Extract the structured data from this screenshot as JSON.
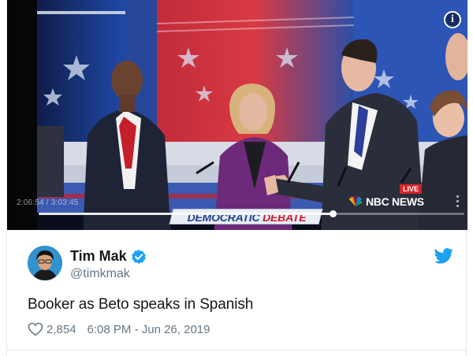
{
  "video": {
    "timestamp": "2:06:54 / 3:03:45",
    "live_label": "LIVE",
    "network_name": "NBC NEWS",
    "banner_part1": "DEMOCRATIC ",
    "banner_part2": "DEBATE",
    "progress_fraction": 0.69,
    "info_label": "i"
  },
  "tweet": {
    "author_name": "Tim Mak",
    "handle": "@timkmak",
    "text": "Booker as Beto speaks in Spanish",
    "likes": "2,854",
    "time": "6:08 PM - Jun 26, 2019"
  },
  "colors": {
    "twitter_blue": "#1da1f2",
    "text_primary": "#14171a",
    "text_secondary": "#657786",
    "live_red": "#d6232a"
  },
  "icons": {
    "info": "info-icon",
    "network": "peacock-icon",
    "verified": "verified-badge-icon",
    "twitter": "twitter-bird-icon",
    "like": "heart-icon",
    "more": "more-vertical-icon"
  }
}
